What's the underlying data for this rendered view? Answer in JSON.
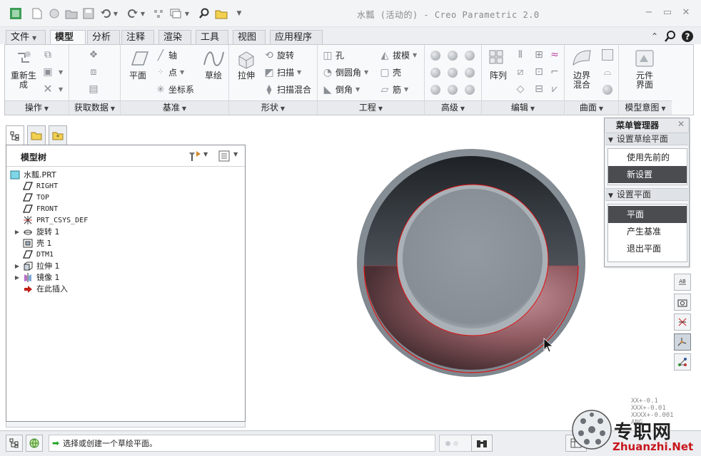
{
  "titlebar": {
    "title": "水瓢 (活动的) - Creo Parametric 2.0"
  },
  "ribbon": {
    "tabs": [
      {
        "label": "文件",
        "dropdown": true
      },
      {
        "label": "模型",
        "active": true
      },
      {
        "label": "分析"
      },
      {
        "label": "注释"
      },
      {
        "label": "渲染"
      },
      {
        "label": "工具"
      },
      {
        "label": "视图"
      },
      {
        "label": "应用程序"
      }
    ],
    "groups": {
      "operations": {
        "footer": "操作",
        "regenerate": "重新生",
        "regenerate2": "成"
      },
      "get_data": {
        "footer": "获取数据"
      },
      "datum": {
        "footer": "基准",
        "plane": "平面",
        "axis": "轴",
        "point": "点",
        "csys": "坐标系",
        "sketch": "草绘"
      },
      "shapes": {
        "footer": "形状",
        "extrude": "拉伸",
        "revolve": "旋转",
        "sweep": "扫描",
        "swept_blend": "扫描混合"
      },
      "engineering": {
        "footer": "工程",
        "hole": "孔",
        "round": "倒圆角",
        "chamfer": "倒角",
        "draft": "拔模",
        "shell": "壳",
        "rib": "筋"
      },
      "advanced": {
        "footer": "高级"
      },
      "editing": {
        "footer": "编辑",
        "pattern": "阵列"
      },
      "surfaces": {
        "footer": "曲面",
        "boundary": "边界",
        "boundary2": "混合"
      },
      "model_intent": {
        "footer": "模型意图",
        "component": "元件",
        "component2": "界面"
      }
    }
  },
  "model_tree": {
    "title": "模型树",
    "items": [
      {
        "label": "水瓢.PRT",
        "icon": "part-icon",
        "expander": false
      },
      {
        "label": "RIGHT",
        "icon": "datum-plane-icon",
        "expander": false
      },
      {
        "label": "TOP",
        "icon": "datum-plane-icon",
        "expander": false
      },
      {
        "label": "FRONT",
        "icon": "datum-plane-icon",
        "expander": false
      },
      {
        "label": "PRT_CSYS_DEF",
        "icon": "csys-icon",
        "expander": false
      },
      {
        "label": "旋转 1",
        "icon": "revolve-icon",
        "expander": true
      },
      {
        "label": "壳 1",
        "icon": "shell-icon",
        "expander": false
      },
      {
        "label": "DTM1",
        "icon": "datum-plane-icon",
        "expander": false
      },
      {
        "label": "拉伸 1",
        "icon": "extrude-icon",
        "expander": true
      },
      {
        "label": "镜像 1",
        "icon": "mirror-icon",
        "expander": true
      },
      {
        "label": "在此插入",
        "icon": "insert-arrow-icon",
        "expander": false
      }
    ]
  },
  "menu_manager": {
    "title": "菜单管理器",
    "section1": {
      "label": "设置草绘平面",
      "items": [
        {
          "label": "使用先前的",
          "selected": false
        },
        {
          "label": "新设置",
          "selected": true
        }
      ]
    },
    "section2": {
      "label": "设置平面",
      "items": [
        {
          "label": "平面",
          "selected": true
        },
        {
          "label": "产生基准",
          "selected": false
        },
        {
          "label": "退出平面",
          "selected": false
        }
      ]
    }
  },
  "status": {
    "message": "选择或创建一个草绘平面。"
  },
  "tolerance_display": {
    "lines": [
      "XX+-0.1",
      "XXX+-0.01",
      "XXXX+-0.001",
      "ANG."
    ]
  },
  "watermark": {
    "name": "专职网",
    "url": "Zhuanzhi.Net"
  },
  "colors": {
    "ribbon_bg": "#f8f9fa",
    "selected_menu_item": "#4a4c50",
    "model_rim": "#8a929a",
    "model_lower_red": "#8e5a60",
    "highlight_edge": "#e01010"
  }
}
